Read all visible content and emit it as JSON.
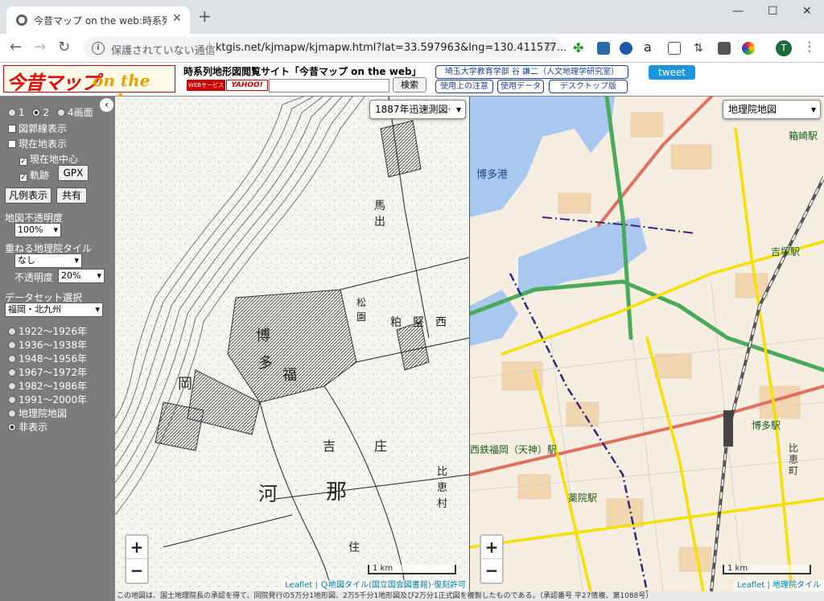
{
  "browser": {
    "tab_title": "今昔マップ on the web:時系列地形",
    "tab_close": "✕",
    "new_tab": "+",
    "security": "保護されていない通信",
    "url": "ktgis.net/kjmapw/kjmapw.html?lat=33.597963&lng=130.411577...",
    "profile_initial": "T",
    "minimize": "—",
    "maximize": "☐",
    "close": "✕"
  },
  "header": {
    "logo_main": "今昔マップ",
    "logo_sub": "on the web",
    "site_title": "時系列地形図閲覧サイト「今昔マップ on the web」",
    "webservice_badge": "WEBサービス",
    "yahoo_badge": "YAHOO!",
    "search_button": "検索",
    "author_link": "埼玉大学教育学部 谷 謙二（人文地理学研究室）",
    "notes_link": "使用上の注意",
    "data_link": "使用データ",
    "desktop_link": "デスクトップ版",
    "tweet_button": "tweet"
  },
  "sidebar": {
    "collapse": "‹",
    "screen_1": "1",
    "screen_2": "2",
    "screen_4": "4画面",
    "grid_lines": "図郭線表示",
    "current_location": "現在地表示",
    "center_current": "現在地中心",
    "track": "軌跡",
    "gpx_button": "GPX",
    "legend_button": "凡例表示",
    "share_button": "共有",
    "opacity_label": "地図不透明度",
    "opacity_value": "100%",
    "overlay_label": "重ねる地理院タイル",
    "overlay_value": "なし",
    "overlay_opacity_label": "不透明度",
    "overlay_opacity_value": "20%",
    "dataset_label": "データセット選択",
    "dataset_value": "福岡・北九州",
    "eras": [
      "1922～1926年",
      "1936～1938年",
      "1948～1956年",
      "1967～1972年",
      "1982～1986年",
      "1991～2000年",
      "地理院地図",
      "非表示"
    ]
  },
  "map_left": {
    "selector": "1887年迅速測図·",
    "zoom_in": "+",
    "zoom_out": "−",
    "scale": "1 km",
    "attribution": "Leaflet | Ｑ地図タイル(国立国会図書館)·復刻許可",
    "place_labels": [
      "博",
      "多",
      "福",
      "岡",
      "吉",
      "那",
      "河",
      "庄",
      "住",
      "西",
      "堅",
      "粕",
      "村",
      "馬",
      "出",
      "松",
      "園",
      "比",
      "恵",
      "村"
    ]
  },
  "map_right": {
    "selector": "地理院地図",
    "zoom_in": "+",
    "zoom_out": "−",
    "scale": "1 km",
    "attribution": "Leaflet | 地理院タイル",
    "labels": {
      "hakata_port": "博多港",
      "hakozaki": "箱崎駅",
      "yoshizuka": "吉塚駅",
      "hakata": "博多駅",
      "tenjin": "西鉄福岡（天神）駅",
      "yakuin": "薬院駅",
      "hie": "比恵町"
    }
  },
  "footer": {
    "note": "この地図は、国土地理院長の承認を得て、同院発行の5万分1地形図、2万5千分1地形図及び2万分1正式図を複製したものである。（承認番号 平27情複、第1088号）"
  },
  "colors": {
    "sidebar_bg": "#7c7c7c",
    "tweet_blue": "#1b95e0",
    "link_border": "#1a3e9a",
    "logo_red": "#e01010",
    "logo_orange": "#e8a000",
    "sea_blue": "#a8c8f0",
    "road_yellow": "#f5e000",
    "road_green": "#4aaa5a",
    "road_red": "#e07060"
  }
}
